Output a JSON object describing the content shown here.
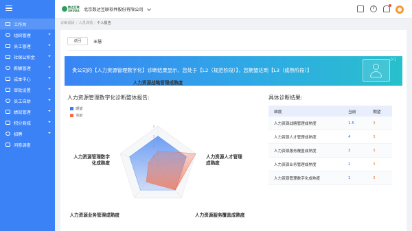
{
  "sidebar": {
    "items": [
      {
        "label": "工作台",
        "icon": "monitor-icon",
        "caret": false
      },
      {
        "label": "组织管理",
        "icon": "org-icon",
        "caret": true
      },
      {
        "label": "员工管理",
        "icon": "user-icon",
        "caret": true
      },
      {
        "label": "社保公积金",
        "icon": "shield-icon",
        "caret": true
      },
      {
        "label": "薪酬管理",
        "icon": "wallet-icon",
        "caret": true
      },
      {
        "label": "成本中心",
        "icon": "cost-icon",
        "caret": true
      },
      {
        "label": "审批设置",
        "icon": "approval-icon",
        "caret": true
      },
      {
        "label": "员工自助",
        "icon": "self-service-icon",
        "caret": true
      },
      {
        "label": "绩效管理",
        "icon": "performance-icon",
        "caret": true
      },
      {
        "label": "积分商城",
        "icon": "store-icon",
        "caret": true
      },
      {
        "label": "招聘",
        "icon": "recruit-icon",
        "caret": true
      },
      {
        "label": "问卷调查",
        "icon": "survey-icon",
        "caret": false
      }
    ]
  },
  "header": {
    "logo_text_top": "数达互联",
    "logo_text_bottom": "SHUDA",
    "company": "北京数达互联软件股份有限公司",
    "icons": [
      "calendar-icon",
      "help-icon",
      "bell-icon",
      "settings-icon",
      "avatar"
    ],
    "help_glyph": "?"
  },
  "breadcrumb": {
    "items": [
      "诊断调研",
      "人员详情",
      "个人报告"
    ],
    "separator": "/"
  },
  "main": {
    "back_label": "返回",
    "person_name": "王慧",
    "banner_text": "贵公司的【人力资源管理数字化】诊断结果显示，您处于【L2（规范阶段）】，您期望达到【L3（成熟阶段）】",
    "banner_tag": "[√]",
    "chart_title": "人力资源管理数字化诊断整体报告:",
    "result_title": "具体诊断结果:",
    "table": {
      "headers": [
        "维度",
        "当前",
        "期望"
      ],
      "rows": [
        {
          "dimension": "人力资源战略管理成熟度",
          "current": "1.5",
          "expected": "3"
        },
        {
          "dimension": "人力资源人才管理成熟度",
          "current": "4",
          "expected": "3"
        },
        {
          "dimension": "人力资源服务覆盖成熟度",
          "current": "3",
          "expected": "3"
        },
        {
          "dimension": "人力资源业务管理成熟度",
          "current": "2",
          "expected": "3"
        },
        {
          "dimension": "人力资源管理数字化成熟度",
          "current": "1",
          "expected": "3"
        }
      ]
    }
  },
  "colors": {
    "sidebar": "#3a82f6",
    "expected_series": "#3b7cf0",
    "current_series": "#f26b4a",
    "current_value_text": "#2f6fe4",
    "expected_value_text": "#f07c36"
  },
  "chart_data": {
    "type": "radar",
    "title": "人力资源管理数字化诊断整体报告:",
    "axes": [
      "人力资源战略管理成熟度",
      "人力资源人才管理成熟度",
      "人力资源服务覆盖成熟度",
      "人力资源业务管理成熟度",
      "人力资源管理数字化成熟度"
    ],
    "axis_labels_display": [
      [
        "人力资源战略管理成熟度"
      ],
      [
        "人力资源人才管理",
        "成熟度"
      ],
      [
        "人力资源服务覆盖成熟度"
      ],
      [
        "人力资源业务管理成熟度"
      ],
      [
        "人力资源管理数字",
        "化成熟度"
      ]
    ],
    "ticks": [
      "1",
      "2",
      "3",
      "4"
    ],
    "range": [
      0,
      4
    ],
    "series": [
      {
        "name": "期望",
        "values": [
          3,
          3,
          3,
          3,
          3
        ]
      },
      {
        "name": "当前",
        "values": [
          1.5,
          4,
          3,
          2,
          1
        ]
      }
    ],
    "legend_position": "top-left"
  }
}
